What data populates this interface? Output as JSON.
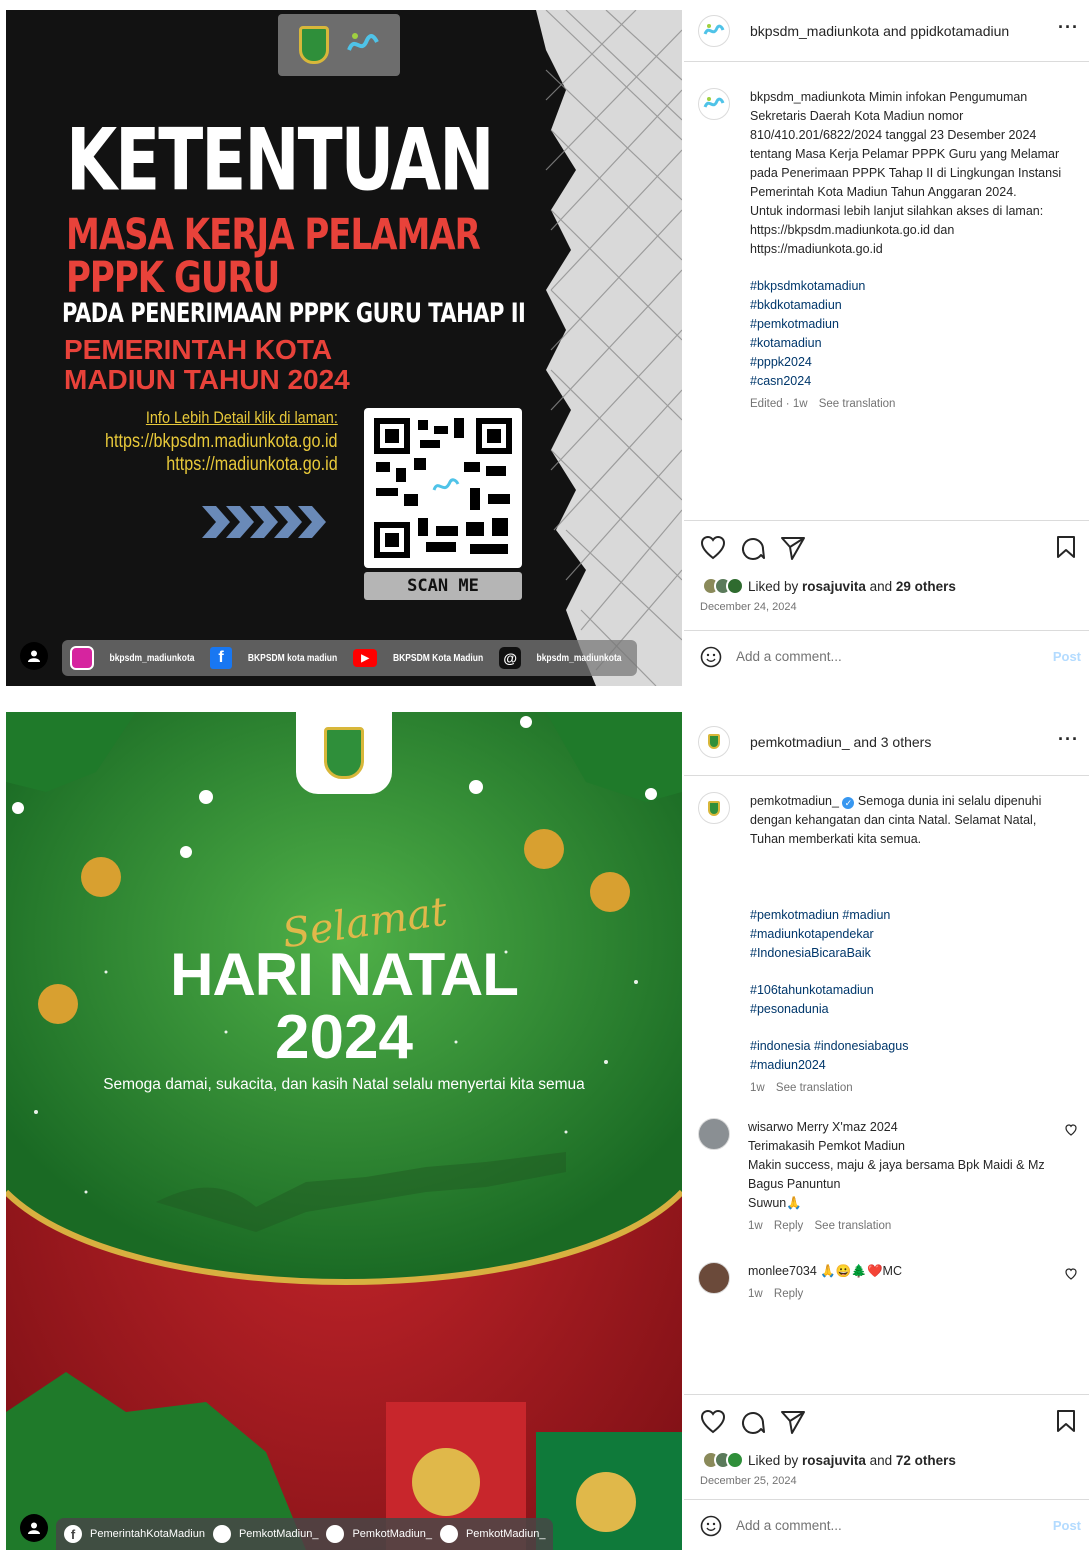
{
  "post1": {
    "image": {
      "title": "KETENTUAN",
      "sub1": "MASA KERJA PELAMAR",
      "sub2": "PPPK GURU",
      "sub3": "PADA PENERIMAAN PPPK GURU TAHAP II",
      "sub4": "PEMERINTAH KOTA",
      "sub5": "MADIUN TAHUN 2024",
      "info_heading": "Info Lebih Detail klik di laman:",
      "info_url1": "https://bkpsdm.madiunkota.go.id",
      "info_url2": "https://madiunkota.go.id",
      "scan": "SCAN ME",
      "social": [
        "bkpsdm_madiunkota",
        "BKPSDM kota madiun",
        "BKPSDM Kota Madiun",
        "bkpsdm_madiunkota"
      ]
    },
    "header": {
      "name": "bkpsdm_madiunkota and ppidkotamadiun"
    },
    "caption": {
      "user": "bkpsdm_madiunkota",
      "text": "Mimin infokan Pengumuman Sekretaris Daerah Kota Madiun nomor 810/410.201/6822/2024 tanggal 23 Desember 2024 tentang Masa Kerja Pelamar PPPK Guru yang Melamar pada Penerimaan PPPK Tahap II di Lingkungan Instansi Pemerintah Kota Madiun Tahun Anggaran 2024.",
      "text2": "Untuk indormasi lebih lanjut silahkan akses di laman:",
      "url1": "https://bkpsdm.madiunkota.go.id dan",
      "url2": "https://madiunkota.go.id",
      "tags": [
        "#bkpsdmkotamadiun",
        "#bkdkotamadiun",
        "#pemkotmadiun",
        "#kotamadiun",
        "#pppk2024",
        "#casn2024"
      ],
      "meta_time": "Edited · 1w",
      "meta_translate": "See translation"
    },
    "likes": {
      "prefix": "Liked by ",
      "user": "rosajuvita",
      "mid": " and ",
      "others": "29 others"
    },
    "date": "December 24, 2024",
    "comment_placeholder": "Add a comment...",
    "post_label": "Post"
  },
  "post2": {
    "image": {
      "script": "Selamat",
      "title": "HARI NATAL",
      "year": "2024",
      "tagline": "Semoga damai, sukacita, dan kasih Natal selalu menyertai kita semua",
      "social": [
        "PemerintahKotaMadiun",
        "PemkotMadiun_",
        "PemkotMadiun_",
        "PemkotMadiun_"
      ]
    },
    "header": {
      "name": "pemkotmadiun_ and 3 others"
    },
    "caption": {
      "user": "pemkotmadiun_",
      "text": "Semoga dunia ini selalu dipenuhi dengan kehangatan dan cinta Natal. Selamat Natal, Tuhan memberkati kita semua.",
      "tags1": "#pemkotmadiun #madiun",
      "tags2": "#madiunkotapendekar",
      "tags3": "#IndonesiaBicaraBaik",
      "tags4": "#106tahunkotamadiun",
      "tags5": "#pesonadunia",
      "tags6": "#indonesia #indonesiabagus",
      "tags7": "#madiun2024",
      "meta_time": "1w",
      "meta_translate": "See translation"
    },
    "comments": [
      {
        "user": "wisarwo",
        "lines": [
          "Merry X'maz 2024",
          "Terimakasih Pemkot Madiun",
          "Makin success, maju & jaya bersama Bpk Maidi & Mz Bagus Panuntun",
          "Suwun🙏"
        ],
        "time": "1w",
        "reply": "Reply",
        "translate": "See translation"
      },
      {
        "user": "monlee7034",
        "text": "🙏😀🌲❤️MC",
        "time": "1w",
        "reply": "Reply"
      }
    ],
    "likes": {
      "prefix": "Liked by ",
      "user": "rosajuvita",
      "mid": " and ",
      "others": "72 others"
    },
    "date": "December 25, 2024",
    "comment_placeholder": "Add a comment...",
    "post_label": "Post"
  }
}
